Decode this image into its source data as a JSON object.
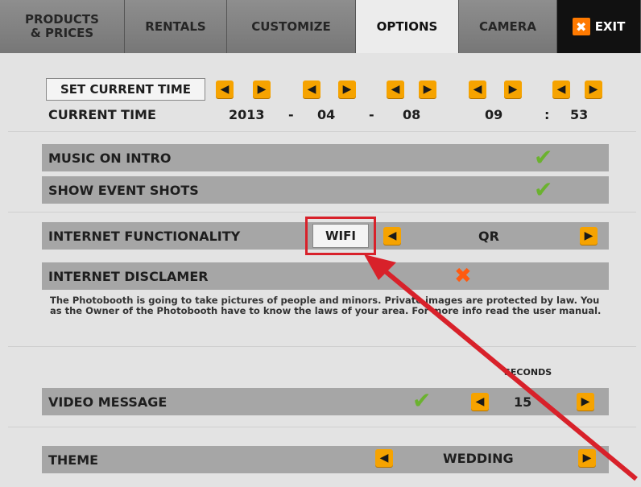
{
  "tabs": [
    {
      "line1": "PRODUCTS",
      "line2": "& PRICES"
    },
    {
      "line1": "RENTALS",
      "line2": ""
    },
    {
      "line1": "CUSTOMIZE",
      "line2": ""
    },
    {
      "line1": "OPTIONS",
      "line2": ""
    },
    {
      "line1": "CAMERA",
      "line2": ""
    }
  ],
  "exit_label": "EXIT",
  "time": {
    "set_button": "SET CURRENT TIME",
    "label": "CURRENT TIME",
    "year": "2013",
    "sep1": "-",
    "month": "04",
    "sep2": "-",
    "day": "08",
    "hour": "09",
    "colon": ":",
    "minute": "53"
  },
  "settings": {
    "music_on_intro": {
      "label": "MUSIC ON INTRO",
      "enabled": true
    },
    "show_event_shots": {
      "label": "SHOW EVENT SHOTS",
      "enabled": true
    }
  },
  "internet": {
    "label": "INTERNET FUNCTIONALITY",
    "wifi_button": "WIFI",
    "mode_value": "QR"
  },
  "disclaimer": {
    "label": "INTERNET DISCLAMER",
    "enabled": false,
    "text": "The Photobooth is going to take pictures of people and minors. Private images are protected by law. You as the Owner of the Photobooth have to know the laws of your area. For more info read the user manual."
  },
  "video": {
    "seconds_label": "SECONDS",
    "label": "VIDEO MESSAGE",
    "enabled": true,
    "seconds_value": "15"
  },
  "theme": {
    "label": "THEME",
    "value": "WEDDING"
  },
  "colors": {
    "accent_orange": "#f6a300",
    "check_green": "#6bb22f",
    "cross_orange": "#ff5a10",
    "highlight_red": "#d8212a"
  }
}
